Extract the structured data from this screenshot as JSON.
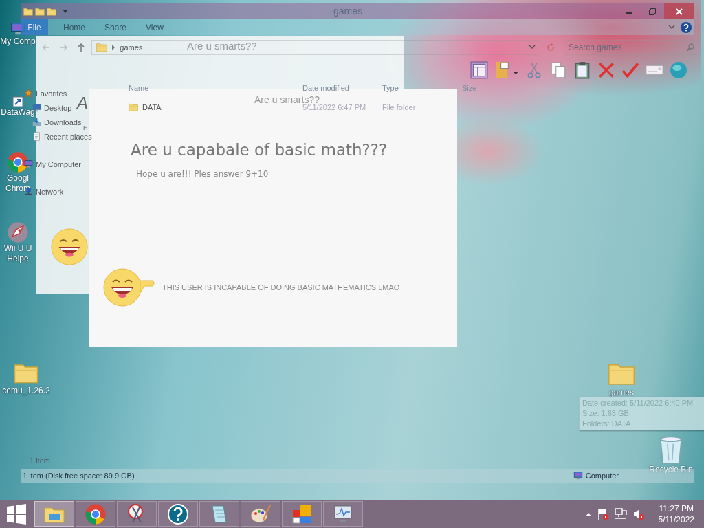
{
  "desktop": {
    "icons_left": [
      {
        "kind": "computer",
        "lines": [
          "My Comp"
        ]
      },
      {
        "kind": "shortcut",
        "lines": [
          "DataWag"
        ]
      },
      {
        "kind": "chrome",
        "lines": [
          "Googl",
          "Chrom"
        ]
      },
      {
        "kind": "rocket",
        "lines": [
          "Wii U U",
          "Helpe"
        ]
      },
      {
        "kind": "folder",
        "lines": [
          "cemu_1.26.2"
        ]
      }
    ],
    "icons_right": [
      {
        "kind": "folder",
        "lines": [
          "games"
        ]
      },
      {
        "kind": "recycle",
        "lines": [
          "Recycle Bin"
        ]
      }
    ],
    "tooltip": {
      "lines": [
        "Date created: 5/11/2022 6:40 PM",
        "Size: 1.63 GB",
        "Folders: DATA"
      ]
    }
  },
  "explorer": {
    "title": "games",
    "ribbon_tabs": [
      {
        "label": "File",
        "kind": "file"
      },
      {
        "label": "Home",
        "kind": "tab"
      },
      {
        "label": "Share",
        "kind": "tab"
      },
      {
        "label": "View",
        "kind": "tab"
      }
    ],
    "address": {
      "path": "games"
    },
    "search": {
      "placeholder": "Search games"
    },
    "toolbar": [
      {
        "kind": "layout"
      },
      {
        "kind": "properties"
      },
      {
        "kind": "cut"
      },
      {
        "kind": "copy"
      },
      {
        "kind": "paste"
      },
      {
        "kind": "delete"
      },
      {
        "kind": "check"
      },
      {
        "kind": "rename"
      },
      {
        "kind": "globe"
      }
    ],
    "nav": [
      {
        "kind": "star",
        "label": "Favorites",
        "children": [
          {
            "kind": "desktop",
            "label": "Desktop"
          },
          {
            "kind": "download",
            "label": "Downloads"
          },
          {
            "kind": "recent",
            "label": "Recent places"
          }
        ]
      },
      {
        "kind": "computer",
        "label": "My Computer"
      },
      {
        "kind": "network",
        "label": "Network"
      }
    ],
    "columns": [
      "Name",
      "Date modified",
      "Type",
      "Size"
    ],
    "rows": [
      {
        "name": "DATA",
        "date_modified": "5/11/2022 6:47 PM",
        "type": "File folder"
      }
    ],
    "item_count": "1 item",
    "status_bar": {
      "text": "1 item (Disk free space: 89.9 GB)",
      "location": "Computer"
    }
  },
  "inner_window": {
    "title": "Are u smarts??",
    "stray_letters": [
      "A",
      "H"
    ]
  },
  "dialog": {
    "title": "Are u smarts??",
    "heading": "Are u capabale of basic math???",
    "prompt": "Hope u are!!! Ples answer 9+10",
    "message": "THIS USER IS INCAPABLE OF DOING BASIC MATHEMATICS LMAO"
  },
  "taskbar": {
    "apps": [
      {
        "kind": "explorer",
        "selected": true
      },
      {
        "kind": "chrome",
        "selected": false
      },
      {
        "kind": "snip",
        "selected": false
      },
      {
        "kind": "help",
        "selected": false
      },
      {
        "kind": "notepad",
        "selected": false
      },
      {
        "kind": "paint",
        "selected": false
      },
      {
        "kind": "tiles",
        "selected": false
      },
      {
        "kind": "monitor",
        "selected": false
      }
    ],
    "time": "11:27 PM",
    "date": "5/11/2022"
  }
}
